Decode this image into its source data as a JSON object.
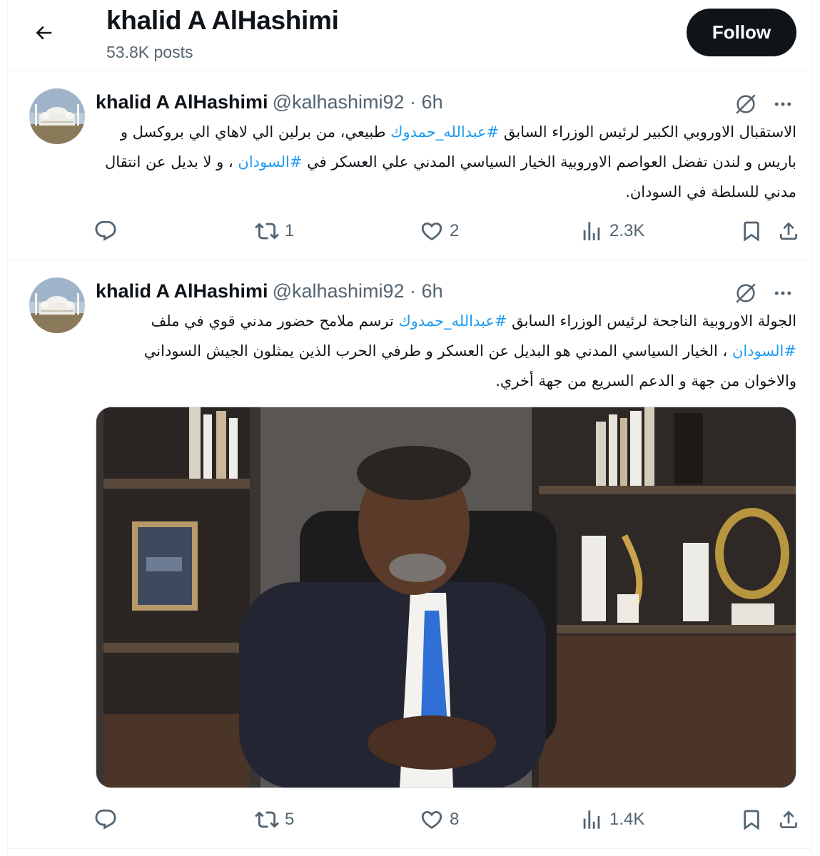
{
  "header": {
    "title": "khalid A AlHashimi",
    "posts_count": "53.8K posts",
    "follow_label": "Follow"
  },
  "tweets": [
    {
      "name": "khalid A AlHashimi",
      "meta": "@kalhashimi92 · 6h",
      "text": {
        "p1": "الاستقبال الاوروبي الكبير لرئيس الوزراء السابق ",
        "tag1": "#عبدالله_حمدوك",
        "p2": " طبيعي، من برلين الي لاهاي الي بروكسل و باريس و لندن تفضل العواصم الاوروبية الخيار السياسي المدني علي العسكر في ",
        "tag2": "#السودان",
        "p3": " ، و لا بديل عن انتقال مدني للسلطة في السودان."
      },
      "replies": "",
      "reposts": "1",
      "likes": "2",
      "views": "2.3K"
    },
    {
      "name": "khalid A AlHashimi",
      "meta": "@kalhashimi92 · 6h",
      "text": {
        "p1": "الجولة الاوروبية الناجحة لرئيس الوزراء السابق ",
        "tag1": "#عبدالله_حمدوك",
        "p2": " ترسم ملامح حضور مدني قوي في ملف ",
        "tag2": "#السودان",
        "p3": " ، الخيار السياسي المدني هو البديل عن العسكر و طرفي الحرب الذين يمثلون الجيش السوداني والاخوان من جهة و الدعم السريع من جهة أخري."
      },
      "replies": "",
      "reposts": "5",
      "likes": "8",
      "views": "1.4K"
    }
  ],
  "icons": {
    "back": "arrow-left-icon",
    "grok": "grok-icon",
    "more": "more-horizontal-icon",
    "reply": "reply-icon",
    "repost": "repost-icon",
    "like": "heart-icon",
    "views": "views-chart-icon",
    "bookmark": "bookmark-icon",
    "share": "share-icon"
  },
  "colors": {
    "accent": "#1d9bf0",
    "text": "#0f1419",
    "muted": "#536471",
    "border": "#eff3f4",
    "button": "#0f1419"
  }
}
